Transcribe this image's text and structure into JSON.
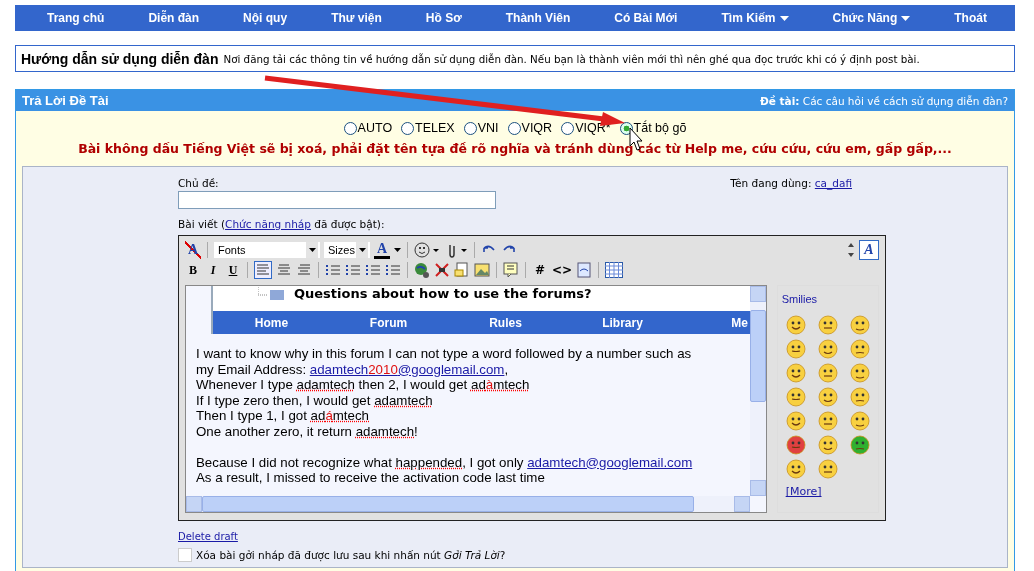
{
  "nav": [
    {
      "label": "Trang chủ",
      "dropdown": false
    },
    {
      "label": "Diễn đàn",
      "dropdown": false
    },
    {
      "label": "Nội quy",
      "dropdown": false
    },
    {
      "label": "Thư viện",
      "dropdown": false
    },
    {
      "label": "Hồ Sơ",
      "dropdown": false
    },
    {
      "label": "Thành Viên",
      "dropdown": false
    },
    {
      "label": "Có Bài Mới",
      "dropdown": false
    },
    {
      "label": "Tìm Kiếm",
      "dropdown": true
    },
    {
      "label": "Chức Năng",
      "dropdown": true
    },
    {
      "label": "Thoát",
      "dropdown": false
    }
  ],
  "forum_info": {
    "title": "Hướng dẫn sử dụng diễn đàn",
    "description": "Nơi đăng tải các thông tin về hướng dẫn sử dụng diễn đàn. Nếu bạn là thành viên mới thì nên ghé qua đọc trước khi có ý định post bài."
  },
  "reply_panel": {
    "title": "Trả Lời Đề Tài",
    "topic_label": "Đề tài:",
    "topic": "Các câu hỏi về cách sử dụng diễn đàn?",
    "input_methods": [
      {
        "label": "AUTO",
        "selected": false
      },
      {
        "label": "TELEX",
        "selected": false
      },
      {
        "label": "VNI",
        "selected": false
      },
      {
        "label": "VIQR",
        "selected": false
      },
      {
        "label": "VIQR*",
        "selected": false
      },
      {
        "label": "Tắt bộ gõ",
        "selected": true
      }
    ],
    "warning": "Bài không dấu Tiếng Việt sẽ bị xoá, phải đặt tên tựa đề rõ nghĩa và tránh dùng các từ Help me, cứu cứu, cứu em, gấp gấp,...",
    "subject_label": "Chủ đề:",
    "user_label": "Tên đang dùng:",
    "username": "ca_dafi",
    "post_label_before": "Bài viết (",
    "draft_link": "Chức năng nháp",
    "post_label_after": "đã được bật):",
    "editor": {
      "remove_format": "A",
      "text_color": "A",
      "switch_mode": "A",
      "font_select": "Fonts",
      "size_select": "Sizes",
      "bold": "B",
      "italic": "I",
      "underline": "U",
      "hash": "#",
      "code": "<>",
      "embedded": {
        "title": "Questions about how to use the forums?",
        "nav": [
          "Home",
          "Forum",
          "Rules",
          "Library",
          "Me"
        ]
      },
      "paragraphs": [
        [
          [
            {
              "kind": "text",
              "text": "I want to know why in this forum I can not type a word followed by a number such as"
            }
          ],
          [
            {
              "kind": "text",
              "text": "my Email Address: "
            },
            {
              "kind": "link",
              "parts": [
                {
                  "text": "adamtech",
                  "highlight": false
                },
                {
                  "text": "2010",
                  "highlight": true
                },
                {
                  "text": "@googlemail.com",
                  "highlight": false
                }
              ]
            },
            {
              "kind": "text",
              "text": ","
            }
          ],
          [
            {
              "kind": "text",
              "text": "Whenever I type "
            },
            {
              "kind": "spell",
              "parts": [
                {
                  "text": "adamtech",
                  "highlight": false
                }
              ]
            },
            {
              "kind": "text",
              "text": " then 2, I would get "
            },
            {
              "kind": "spell",
              "parts": [
                {
                  "text": "ad",
                  "highlight": false
                },
                {
                  "text": "à",
                  "highlight": true
                },
                {
                  "text": "mtech",
                  "highlight": false
                }
              ]
            }
          ],
          [
            {
              "kind": "text",
              "text": "If I type zero then, I would get "
            },
            {
              "kind": "spell",
              "parts": [
                {
                  "text": "adamtech",
                  "highlight": false
                }
              ]
            }
          ],
          [
            {
              "kind": "text",
              "text": "Then I type 1, I got "
            },
            {
              "kind": "spell",
              "parts": [
                {
                  "text": "ad",
                  "highlight": false
                },
                {
                  "text": "á",
                  "highlight": true
                },
                {
                  "text": "mtech",
                  "highlight": false
                }
              ]
            }
          ],
          [
            {
              "kind": "text",
              "text": "One another zero, it return "
            },
            {
              "kind": "spell",
              "parts": [
                {
                  "text": "adamtech",
                  "highlight": false
                }
              ]
            },
            {
              "kind": "text",
              "text": "!"
            }
          ]
        ],
        [
          [
            {
              "kind": "text",
              "text": "Because I did not recognize what "
            },
            {
              "kind": "spell",
              "parts": [
                {
                  "text": "happended",
                  "highlight": false
                }
              ]
            },
            {
              "kind": "text",
              "text": ", I got only "
            },
            {
              "kind": "link",
              "parts": [
                {
                  "text": "adamtech@googlemail.com",
                  "highlight": false
                }
              ]
            }
          ],
          [
            {
              "kind": "text",
              "text": "As a result, I missed to receive the activation code last time"
            }
          ]
        ]
      ],
      "smilies_title": "Smilies",
      "more": "[More]"
    },
    "delete_draft": "Delete draft",
    "clear_draft": {
      "label": "Xóa bài gởi nháp đã được lưu sau khi nhấn nút *Gởi Trả Lời*?",
      "checked": false
    }
  }
}
